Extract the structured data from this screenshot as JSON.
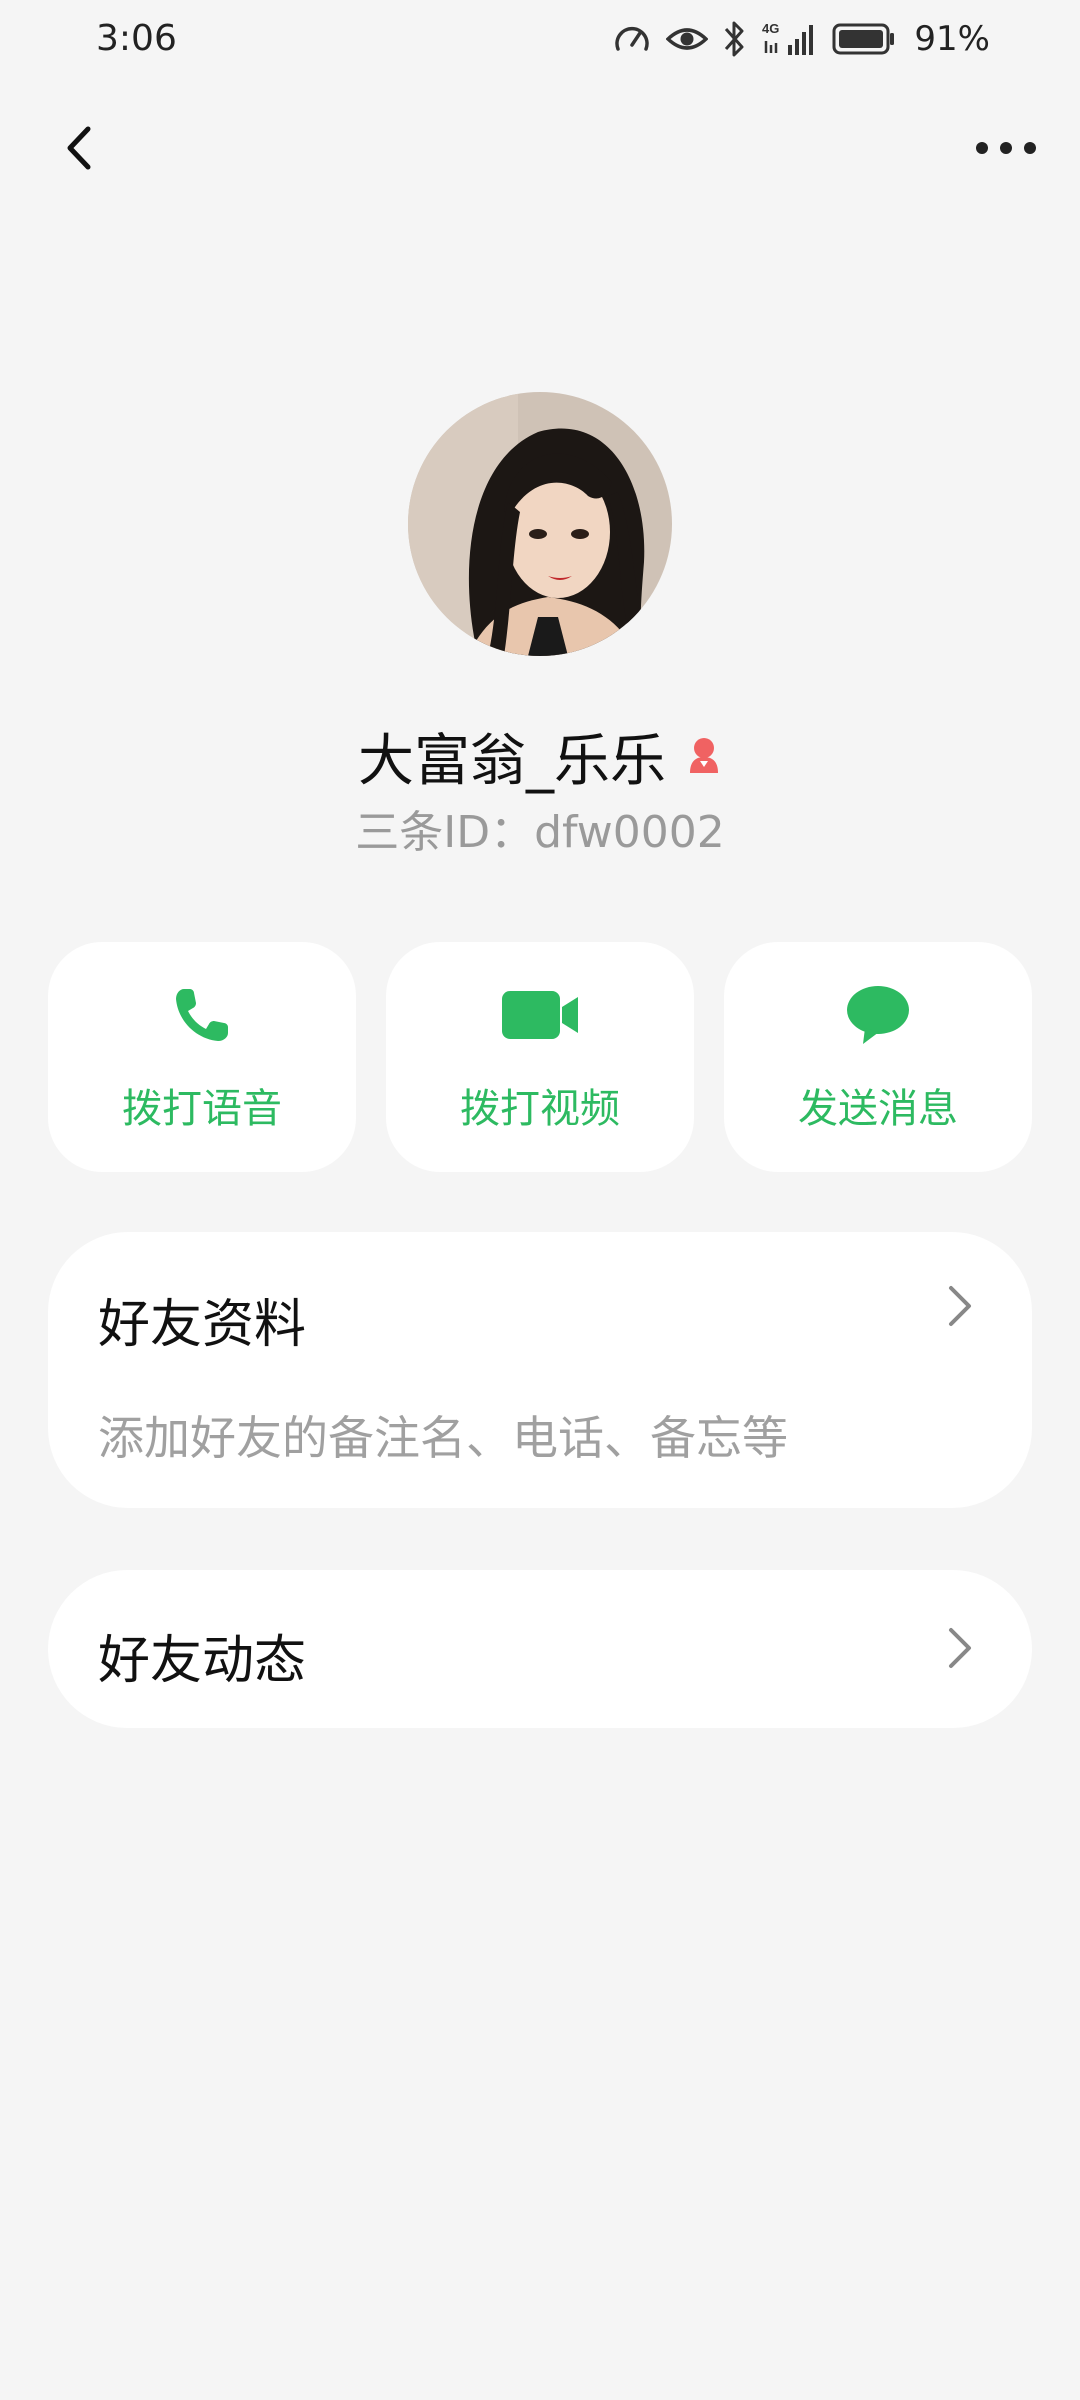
{
  "status_bar": {
    "time": "3:06",
    "signal_label": "4G",
    "battery": "91%",
    "icons": [
      "speedometer-icon",
      "eye-icon",
      "bluetooth-icon",
      "signal-icon",
      "battery-icon"
    ]
  },
  "header": {
    "back_icon": "chevron-left-icon",
    "more_icon": "more-horizontal-icon"
  },
  "profile": {
    "name": "大富翁_乐乐",
    "gender_icon": "female-user-icon",
    "id_line": "三条ID：dfw0002"
  },
  "actions": [
    {
      "label": "拨打语音",
      "icon": "phone-icon"
    },
    {
      "label": "拨打视频",
      "icon": "video-camera-icon"
    },
    {
      "label": "发送消息",
      "icon": "chat-bubble-icon"
    }
  ],
  "friend_info": {
    "title": "好友资料",
    "subtitle": "添加好友的备注名、电话、备忘等"
  },
  "friend_feed": {
    "title": "好友动态"
  },
  "colors": {
    "accent_green": "#2dba61",
    "gender_red": "#f06262",
    "background": "#f5f5f5",
    "secondary_text": "#9a9a9a"
  }
}
